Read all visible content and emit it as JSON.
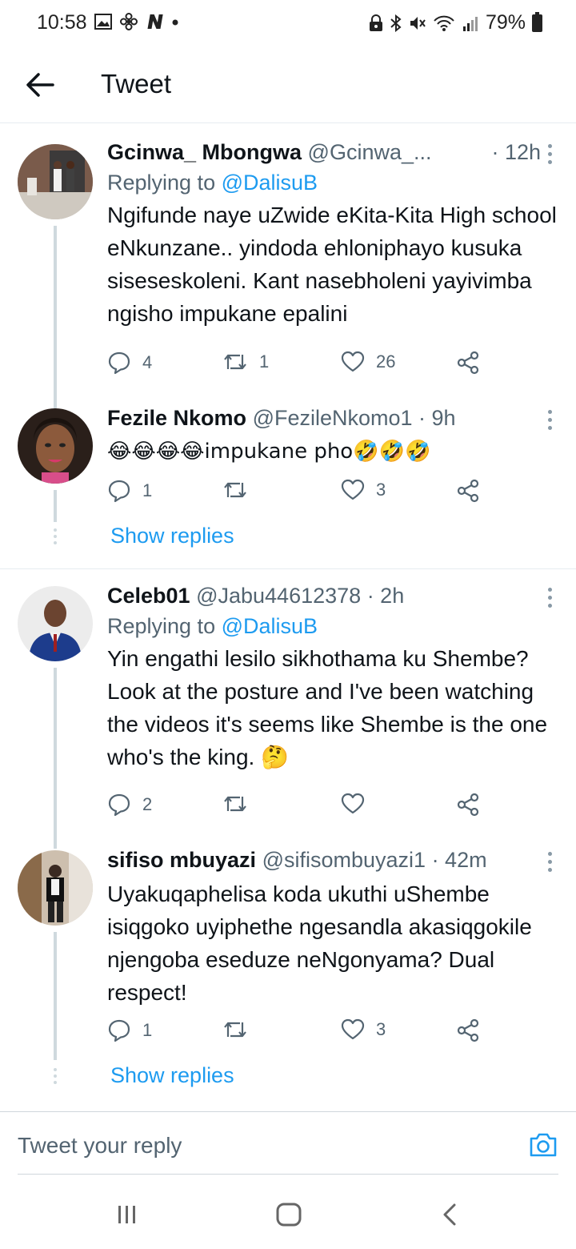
{
  "status_bar": {
    "time": "10:58",
    "battery": "79%",
    "left_icons": [
      "gallery-icon",
      "fan-icon",
      "n-icon",
      "dot-icon"
    ],
    "right_icons": [
      "lock-icon",
      "bluetooth-icon",
      "mute-icon",
      "wifi-icon",
      "signal-icon",
      "battery-icon"
    ]
  },
  "header": {
    "title": "Tweet"
  },
  "tweets": [
    {
      "name": "Gcinwa_ Mbongwa",
      "handle": "@Gcinwa_...",
      "time": "· 12h",
      "replying_prefix": "Replying to ",
      "replying_to": "@DalisuB",
      "text": "Ngifunde naye uZwide eKita-Kita High school eNkunzane.. yindoda ehloniphayo kusuka siseseskoleni. Kant nasebholeni yayivimba ngisho impukane epalini",
      "replies": "4",
      "retweets": "1",
      "likes": "26"
    },
    {
      "name": "Fezile Nkomo",
      "handle": "@FezileNkomo1",
      "time": "· 9h",
      "text": "😂😂😂😂impukane pho🤣🤣🤣",
      "replies": "1",
      "retweets": "",
      "likes": "3",
      "show_replies": "Show replies"
    },
    {
      "name": "Celeb01",
      "handle": "@Jabu44612378",
      "time": "· 2h",
      "replying_prefix": "Replying to ",
      "replying_to": "@DalisuB",
      "text": "Yin engathi lesilo sikhothama ku Shembe? Look at the posture and I've been watching the videos it's seems like Shembe is the one who's the king. 🤔",
      "replies": "2",
      "retweets": "",
      "likes": ""
    },
    {
      "name": "sifiso mbuyazi",
      "handle": "@sifisombuyazi1",
      "time": "· 42m",
      "text": "Uyakuqaphelisa koda ukuthi uShembe isiqgoko uyiphethe ngesandla akasiqgokile njengoba eseduze neNgonyama? Dual respect!",
      "replies": "1",
      "retweets": "",
      "likes": "3",
      "show_replies": "Show replies"
    }
  ],
  "compose": {
    "placeholder": "Tweet your reply"
  },
  "colors": {
    "accent": "#1d9bf0",
    "secondary_text": "#536471",
    "text": "#0f1419"
  }
}
